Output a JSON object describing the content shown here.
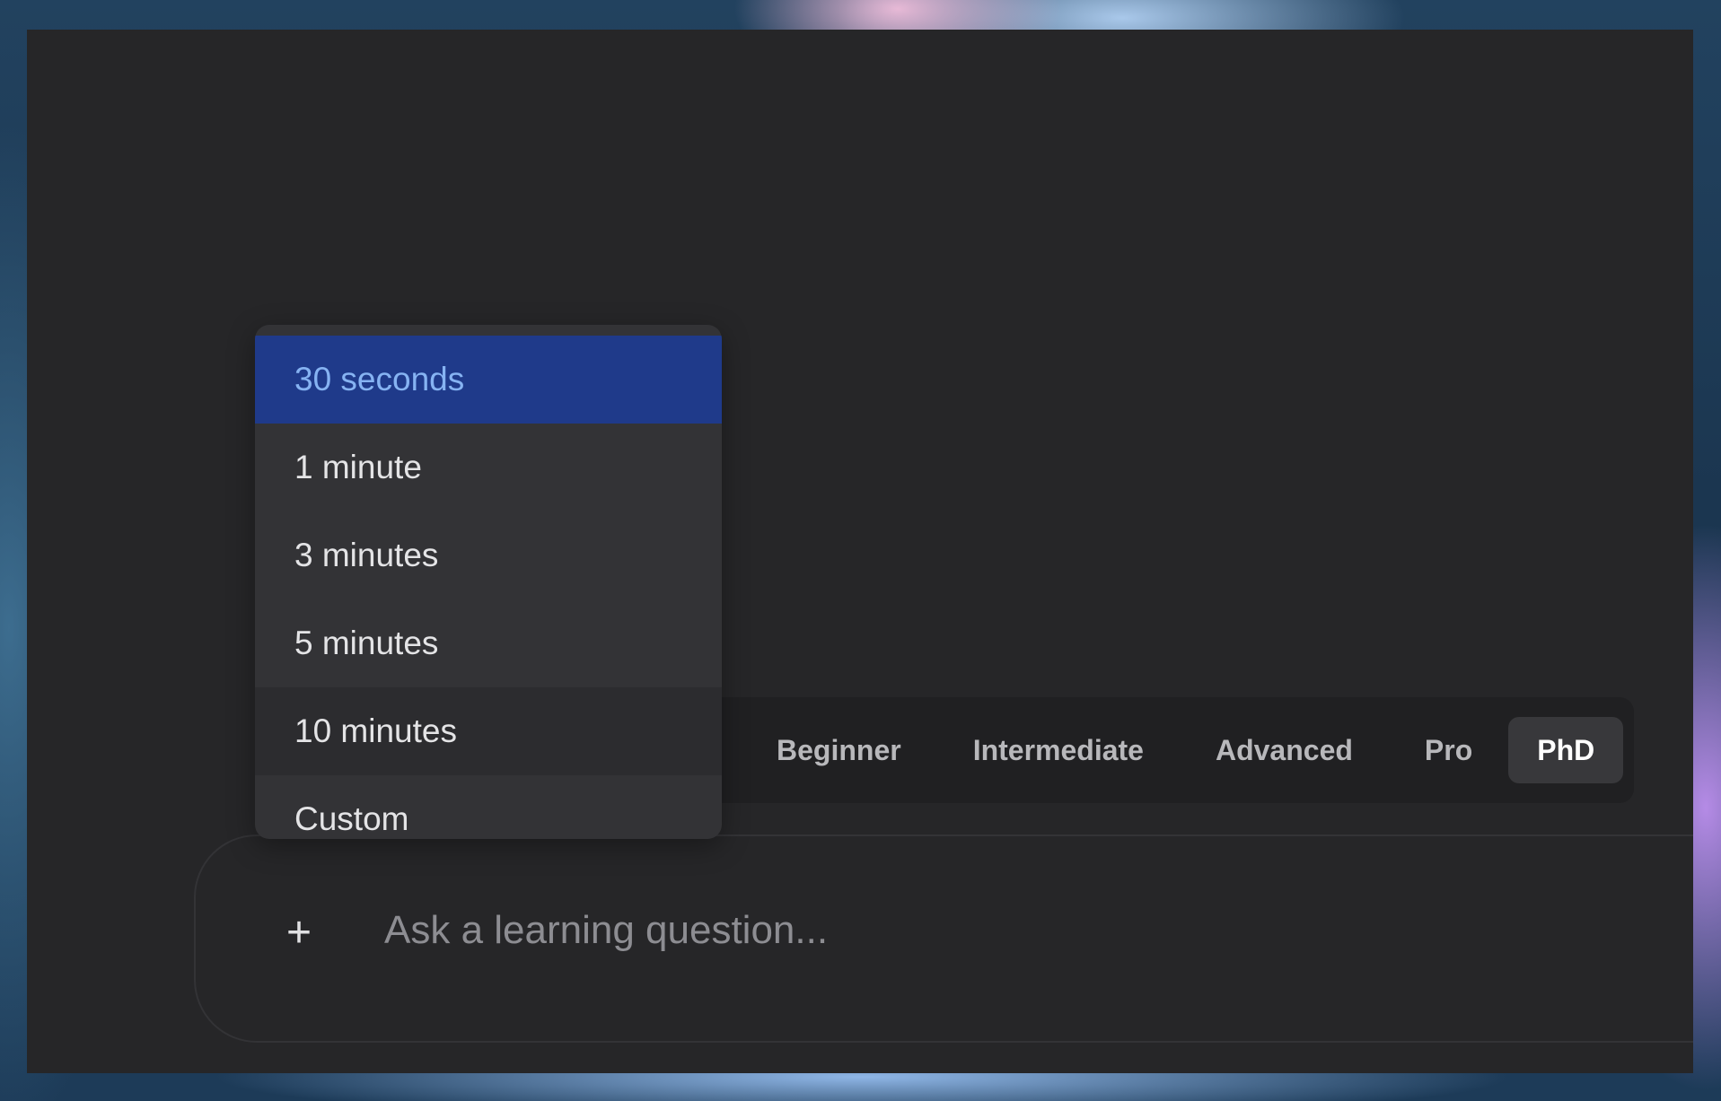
{
  "levels": {
    "items": [
      {
        "label": "Beginner"
      },
      {
        "label": "Intermediate"
      },
      {
        "label": "Advanced"
      },
      {
        "label": "Pro"
      },
      {
        "label": "PhD"
      }
    ],
    "selected": "PhD"
  },
  "duration_menu": {
    "items": [
      {
        "label": "30 seconds"
      },
      {
        "label": "1 minute"
      },
      {
        "label": "3 minutes"
      },
      {
        "label": "5 minutes"
      },
      {
        "label": "10 minutes"
      },
      {
        "label": "Custom"
      }
    ],
    "selected": "30 seconds"
  },
  "chat_input": {
    "placeholder": "Ask a learning question...",
    "value": "",
    "add_icon": "plus-icon"
  },
  "colors": {
    "window_bg": "#262628",
    "menu_bg": "#333336",
    "selected_bg": "#1f3a8a",
    "selected_text": "#86b3f2",
    "active_level_bg": "#38383b"
  }
}
